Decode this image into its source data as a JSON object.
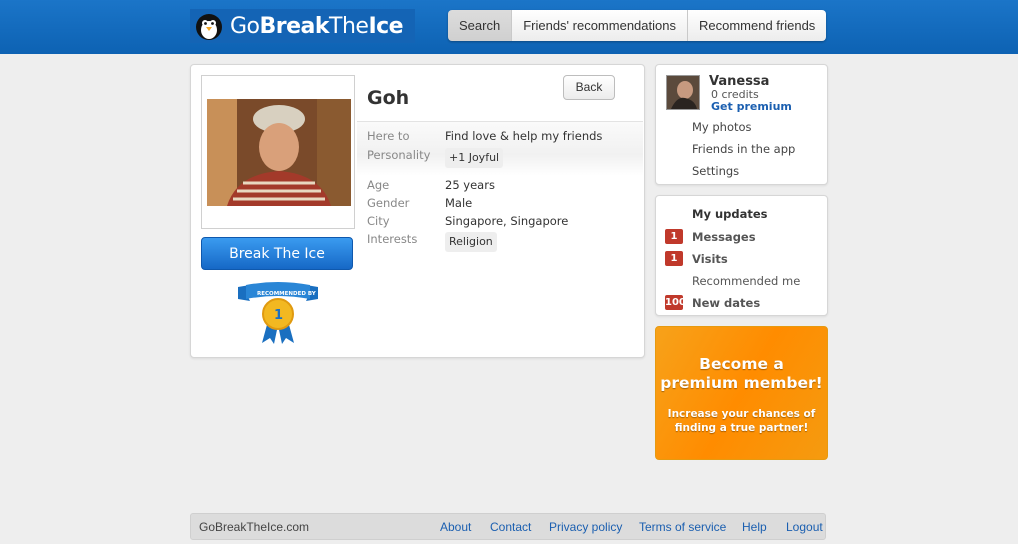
{
  "header": {
    "logo_text_go": "Go",
    "logo_text_break": "Break",
    "logo_text_the": "The",
    "logo_text_ice": "Ice",
    "nav": [
      "Search",
      "Friends' recommendations",
      "Recommend friends"
    ],
    "active_tab": "Search"
  },
  "profile": {
    "name": "Goh",
    "back_label": "Back",
    "break_button": "Break The Ice",
    "ribbon_text": "RECOMMENDED BY",
    "ribbon_count": "1",
    "fields": {
      "here_to_label": "Here to",
      "here_to_value": "Find love & help my friends",
      "personality_label": "Personality",
      "personality_value": "+1 Joyful",
      "age_label": "Age",
      "age_value": "25 years",
      "gender_label": "Gender",
      "gender_value": "Male",
      "city_label": "City",
      "city_value": "Singapore, Singapore",
      "interests_label": "Interests",
      "interests_value": "Religion"
    }
  },
  "sidebar": {
    "user_name": "Vanessa",
    "credits": "0 credits",
    "get_premium": "Get premium",
    "links": [
      "My photos",
      "Friends in the app",
      "Settings"
    ],
    "updates_title": "My updates",
    "updates": [
      {
        "count": "1",
        "label": "Messages"
      },
      {
        "count": "1",
        "label": "Visits"
      },
      {
        "count": "",
        "label": "Recommended me"
      },
      {
        "count": "100",
        "label": "New dates"
      }
    ]
  },
  "promo": {
    "line1": "Become a",
    "line2": "premium member!",
    "sub1": "Increase your chances of",
    "sub2": "finding a true partner!"
  },
  "footer": {
    "copyright": "GoBreakTheIce.com",
    "links": [
      "About",
      "Contact",
      "Privacy policy",
      "Terms of service",
      "Help",
      "Logout"
    ]
  },
  "colors": {
    "header_blue": "#1b75c8",
    "button_blue": "#1668c6",
    "badge_red": "#c0392b",
    "promo_orange": "#ff8c00",
    "link_blue": "#1b5fb0"
  }
}
